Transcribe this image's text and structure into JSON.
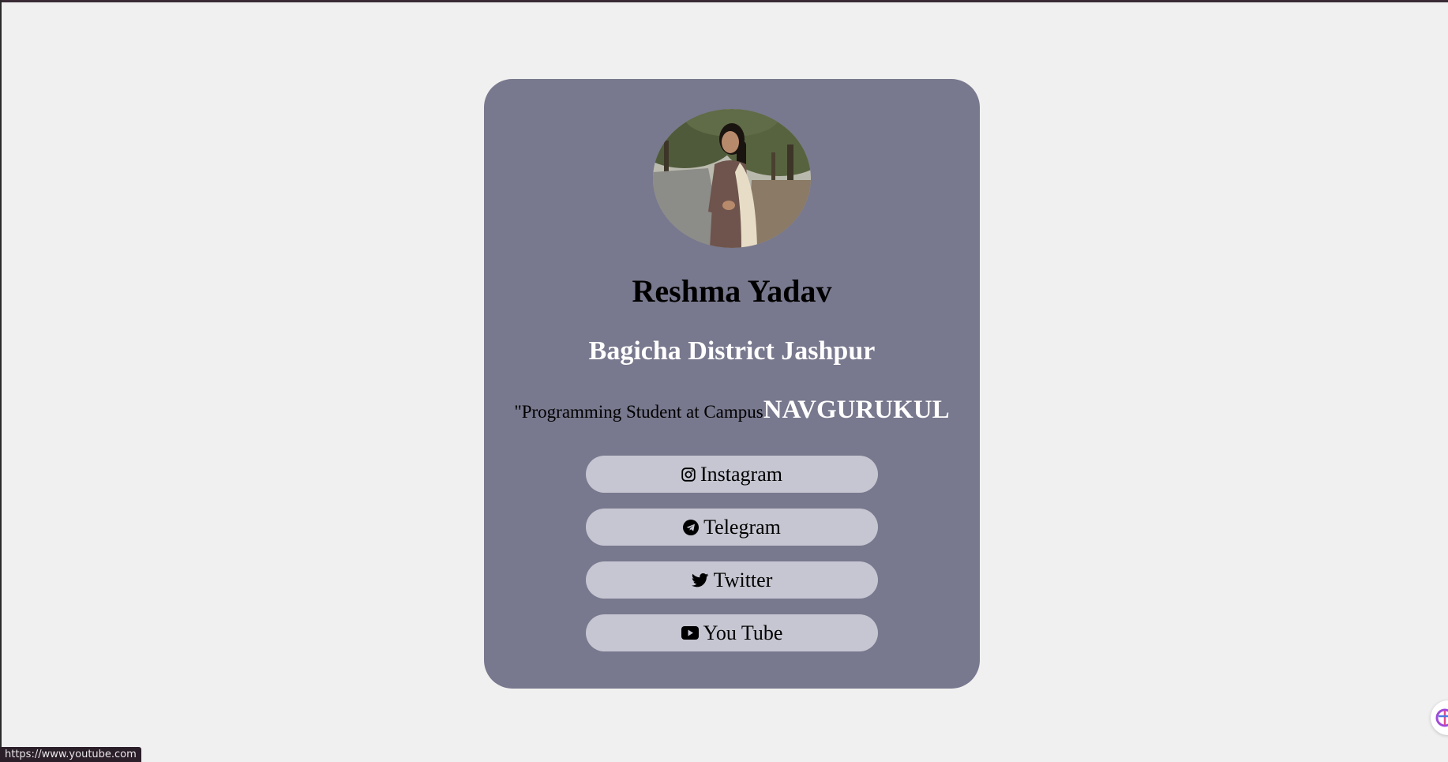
{
  "profile": {
    "name": "Reshma Yadav",
    "location": "Bagicha District Jashpur",
    "tagline_text": "\"Programming Student at Campus",
    "tagline_brand": "NAVGURUKUL"
  },
  "links": [
    {
      "label": "Instagram",
      "icon": "instagram-icon"
    },
    {
      "label": "Telegram",
      "icon": "telegram-icon"
    },
    {
      "label": "Twitter",
      "icon": "twitter-icon"
    },
    {
      "label": "You Tube",
      "icon": "youtube-icon"
    }
  ],
  "status_bar": {
    "url": "https://www.youtube.com"
  },
  "colors": {
    "page_background": "#f0f0f0",
    "card_background": "#78788e",
    "button_background": "#c6c6d2",
    "accent_text": "#ffffff"
  }
}
